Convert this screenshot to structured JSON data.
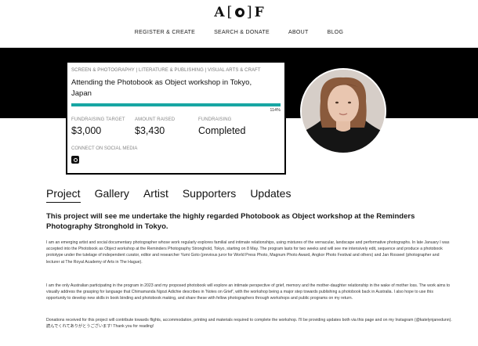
{
  "logo": {
    "left": "A",
    "bracket_open": "[",
    "bracket_close": "]",
    "right": "F"
  },
  "nav": [
    "REGISTER & CREATE",
    "SEARCH & DONATE",
    "ABOUT",
    "BLOG"
  ],
  "card": {
    "categories": "SCREEN & PHOTOGRAPHY | LITERATURE & PUBLISHING | VISUAL ARTS & CRAFT",
    "title": "Attending the Photobook as Object workshop in Tokyo, Japan",
    "progress_percent": 114,
    "progress_label": "114%",
    "stats": [
      {
        "label": "FUNDRAISING TARGET",
        "value": "$3,000"
      },
      {
        "label": "AMOUNT RAISED",
        "value": "$3,430"
      },
      {
        "label": "FUNDRAISING",
        "value": "Completed"
      }
    ],
    "connect_label": "CONNECT ON SOCIAL MEDIA",
    "social_icon": "instagram-icon"
  },
  "colors": {
    "accent": "#17a6a3",
    "hero": "#000000"
  },
  "tabs": [
    "Project",
    "Gallery",
    "Artist",
    "Supporters",
    "Updates"
  ],
  "active_tab": "Project",
  "headline": "This project will see me undertake the highly regarded Photobook as Object workshop at the Reminders Photography Stronghold in Tokyo.",
  "paragraphs": [
    "I am an emerging artist and social documentary photographer whose work regularly explores familial and intimate relationships, using mixtures of the vernacular, landscape and performative photographs. In late January I was accepted into the Photobook as Object workshop at the Reminders Photography Stronghold, Tokyo, starting on 8 May. The program lasts for two weeks and will see me intensively edit, sequence and produce a photobook prototype under the tutelage of independent curator, editor and researcher Yumi Goto (previous juror for World Press Photo, Magnum Photo Award, Angkor Photo Festival and others) and Jan Rosseel (photographer and lecturer at The Royal Academy of Arts in The Hague).",
    "I am the only Australian participating in the program in 2023 and my proposed photobook will explore an intimate perspective of grief, memory and the mother-daughter relationship in the wake of mother loss. The work aims to visually address the grasping for language that Chimamanda Ngozi Adichie describes in 'Notes on Grief', with the workshop being a major step towards publishing a photobook back in Australia. I also hope to use this opportunity to develop new skills in book binding and photobook making, and share these with fellow photographers through workshops and public programs on my return.",
    "Donations received for this project will contribute towards flights, accommodation, printing and materials required to complete the workshop. I'll be providing updates both via this page and on my Instagram (@katelynjanedunn). 読んでくれてありがとうございます! Thank you for reading!"
  ]
}
